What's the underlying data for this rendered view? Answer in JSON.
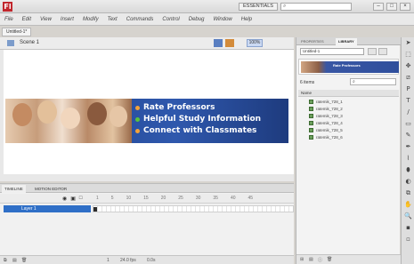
{
  "titlebar": {
    "app_logo": "Fl",
    "workspace": "ESSENTIALS",
    "search_placeholder": "",
    "min": "–",
    "max": "□",
    "close": "×"
  },
  "menu": [
    "File",
    "Edit",
    "View",
    "Insert",
    "Modify",
    "Text",
    "Commands",
    "Control",
    "Debug",
    "Window",
    "Help"
  ],
  "document": {
    "tab_label": "Untitled-1*",
    "scene_label": "Scene 1",
    "zoom": "100%"
  },
  "banner": {
    "lines": [
      "Rate Professors",
      "Helpful Study Information",
      "Connect with Classmates"
    ]
  },
  "timeline": {
    "tabs": [
      "TIMELINE",
      "MOTION EDITOR"
    ],
    "frame_numbers": [
      "1",
      "5",
      "10",
      "15",
      "20",
      "25",
      "30",
      "35",
      "40",
      "45"
    ],
    "layer_name": "Layer 1",
    "footer_frame": "1",
    "footer_fps": "24.0 fps",
    "footer_time": "0.0s"
  },
  "library": {
    "tabs": [
      "PROPERTIES",
      "LIBRARY"
    ],
    "doc_select": "Untitled-1",
    "preview_text": "Rate Professors",
    "items_label": "6 items",
    "search_placeholder": "",
    "name_header": "Name",
    "items": [
      "ratemik_728_1",
      "ratemik_728_2",
      "ratemik_728_3",
      "ratemik_728_4",
      "ratemik_728_5",
      "ratemik_728_6"
    ]
  },
  "tools": [
    "➤",
    "⬚",
    "✥",
    "⧄",
    "P",
    "T",
    "/",
    "▭",
    "✎",
    "✒",
    "⌇",
    "⬮",
    "◐",
    "⧉",
    "✋",
    "🔍",
    "▪",
    "▫"
  ]
}
